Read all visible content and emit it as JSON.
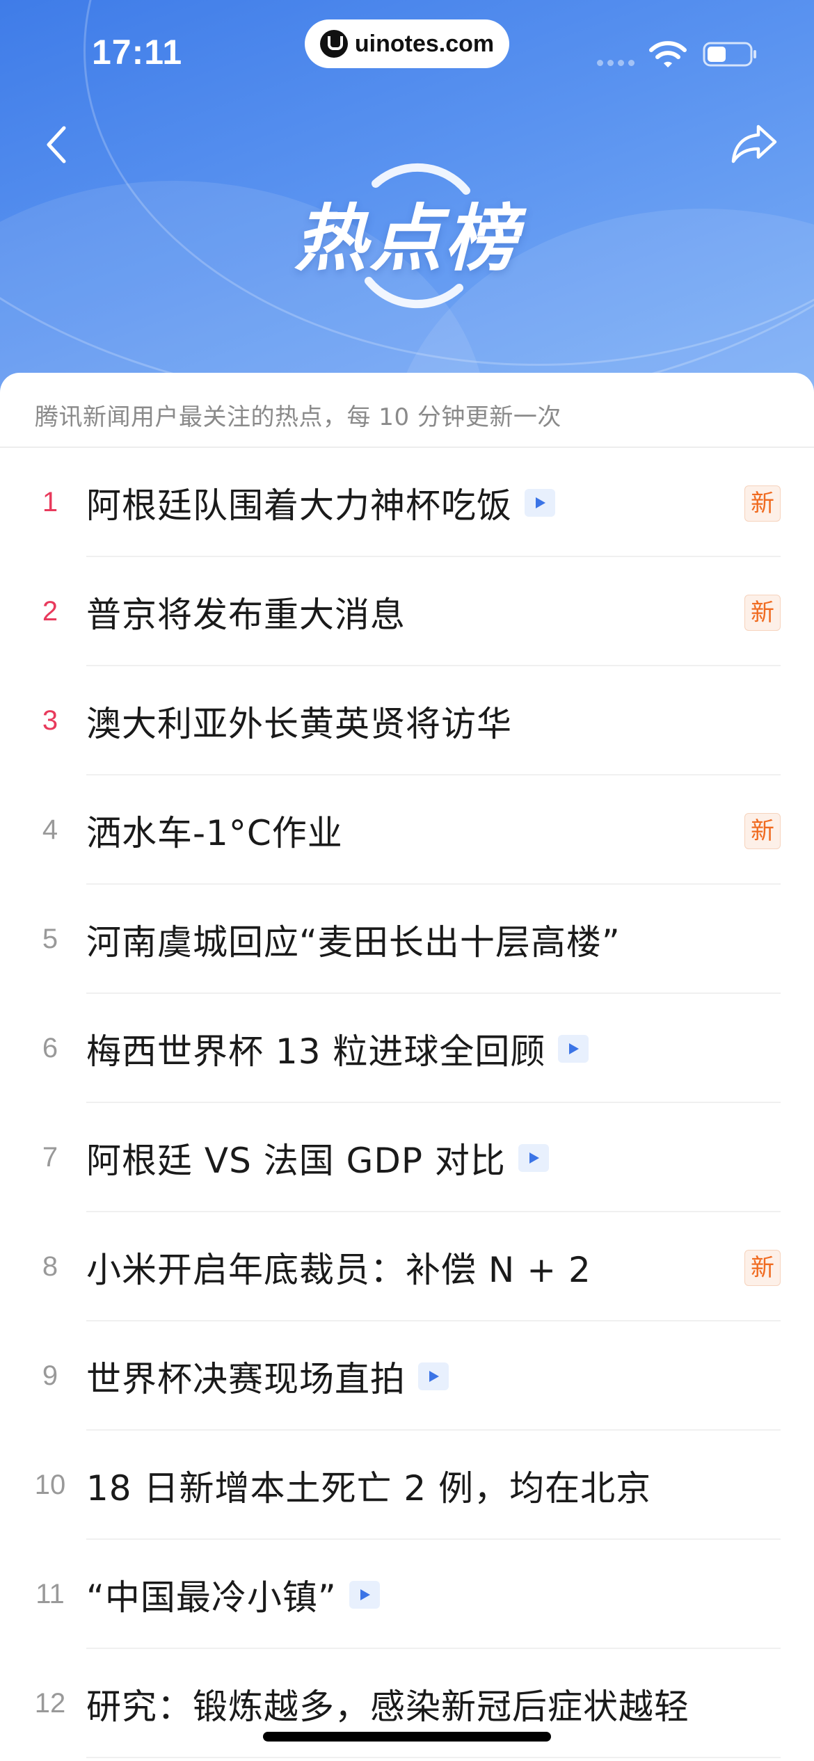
{
  "status_bar": {
    "time": "17:11",
    "watermark": "uinotes.com"
  },
  "header": {
    "title": "热点榜"
  },
  "subtitle": "腾讯新闻用户最关注的热点，每 10 分钟更新一次",
  "colors": {
    "banner": "#4a86ec",
    "top_rank": "#e83a5c",
    "rank": "#999999",
    "new_badge": "#f06a1f",
    "video_badge": "#3b74e6"
  },
  "items": [
    {
      "rank": "1",
      "title": "阿根廷队围着大力神杯吃饭",
      "video": true,
      "new": "新"
    },
    {
      "rank": "2",
      "title": "普京将发布重大消息",
      "video": false,
      "new": "新"
    },
    {
      "rank": "3",
      "title": "澳大利亚外长黄英贤将访华",
      "video": false,
      "new": ""
    },
    {
      "rank": "4",
      "title": "洒水车-1°C作业",
      "video": false,
      "new": "新"
    },
    {
      "rank": "5",
      "title": "河南虞城回应“麦田长出十层高楼”",
      "video": false,
      "new": ""
    },
    {
      "rank": "6",
      "title": "梅西世界杯 13 粒进球全回顾",
      "video": true,
      "new": ""
    },
    {
      "rank": "7",
      "title": "阿根廷 VS 法国 GDP 对比",
      "video": true,
      "new": ""
    },
    {
      "rank": "8",
      "title": "小米开启年底裁员：补偿 N + 2",
      "video": false,
      "new": "新"
    },
    {
      "rank": "9",
      "title": "世界杯决赛现场直拍",
      "video": true,
      "new": ""
    },
    {
      "rank": "10",
      "title": "18 日新增本土死亡 2 例，均在北京",
      "video": false,
      "new": ""
    },
    {
      "rank": "11",
      "title": "“中国最冷小镇”",
      "video": true,
      "new": ""
    },
    {
      "rank": "12",
      "title": "研究：锻炼越多，感染新冠后症状越轻",
      "video": false,
      "new": ""
    }
  ]
}
